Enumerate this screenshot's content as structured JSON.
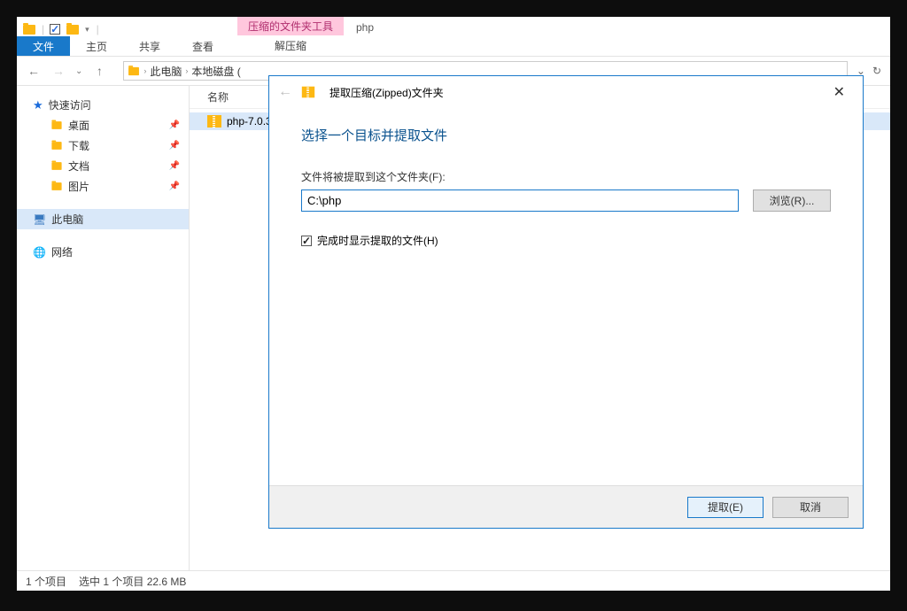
{
  "window": {
    "title": "php",
    "contextual_group": "压缩的文件夹工具",
    "tabs": {
      "file": "文件",
      "home": "主页",
      "share": "共享",
      "view": "查看",
      "extract": "解压缩"
    }
  },
  "address": {
    "segs": [
      "此电脑",
      "本地磁盘 ("
    ]
  },
  "navpane": {
    "quick_access": "快速访问",
    "items": [
      {
        "label": "桌面"
      },
      {
        "label": "下载"
      },
      {
        "label": "文档"
      },
      {
        "label": "图片"
      }
    ],
    "this_pc": "此电脑",
    "network": "网络"
  },
  "columns": {
    "name": "名称"
  },
  "files": [
    {
      "name": "php-7.0.3"
    }
  ],
  "status": {
    "count": "1 个项目",
    "selection": "选中 1 个项目  22.6 MB"
  },
  "dialog": {
    "title": "提取压缩(Zipped)文件夹",
    "heading": "选择一个目标并提取文件",
    "dest_label": "文件将被提取到这个文件夹(F):",
    "dest_value": "C:\\php",
    "browse": "浏览(R)...",
    "show_files": "完成时显示提取的文件(H)",
    "extract": "提取(E)",
    "cancel": "取消"
  }
}
